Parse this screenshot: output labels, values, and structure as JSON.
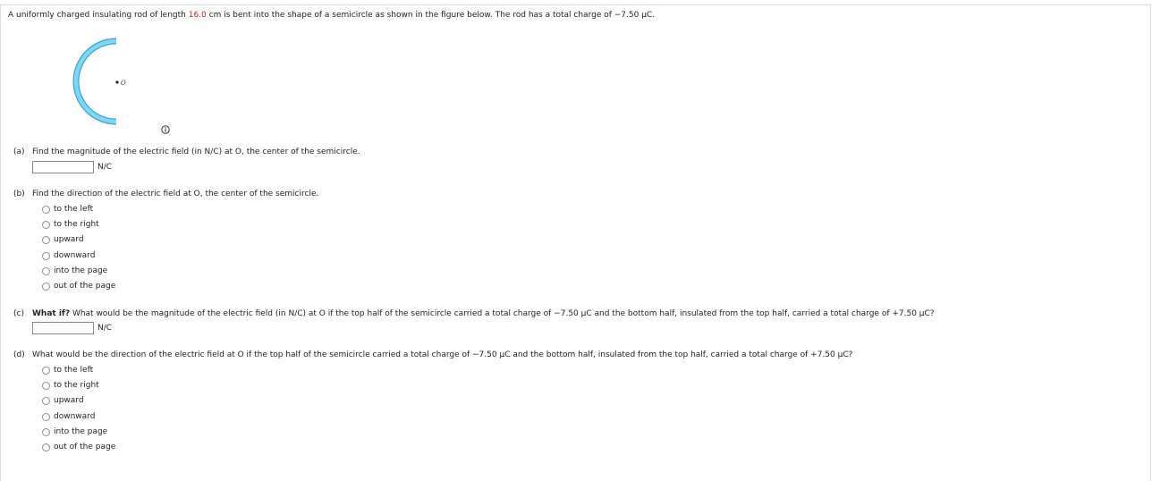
{
  "problem": {
    "intro_before": "A uniformly charged insulating rod of length ",
    "length_value": "16.0",
    "intro_after": " cm is bent into the shape of a semicircle as shown in the figure below. The rod has a total charge of −7.50 µC.",
    "figure_point_label": "O"
  },
  "parts": {
    "a": {
      "label": "(a)",
      "question": "Find the magnitude of the electric field (in N/C) at O, the center of the semicircle.",
      "answer_value": "",
      "unit": "N/C"
    },
    "b": {
      "label": "(b)",
      "question": "Find the direction of the electric field at O, the center of the semicircle.",
      "options": [
        "to the left",
        "to the right",
        "upward",
        "downward",
        "into the page",
        "out of the page"
      ]
    },
    "c": {
      "label": "(c)",
      "bold": "What if?",
      "question": " What would be the magnitude of the electric field (in N/C) at O if the top half of the semicircle carried a total charge of −7.50 µC and the bottom half, insulated from the top half, carried a total charge of +7.50 µC?",
      "answer_value": "",
      "unit": "N/C"
    },
    "d": {
      "label": "(d)",
      "question": "What would be the direction of the electric field at O if the top half of the semicircle carried a total charge of −7.50 µC and the bottom half, insulated from the top half, carried a total charge of +7.50 µC?",
      "options": [
        "to the left",
        "to the right",
        "upward",
        "downward",
        "into the page",
        "out of the page"
      ]
    }
  },
  "colors": {
    "rod": "#5bc8f0",
    "rod_edge": "#3aa6d4",
    "highlight": "#cc2222"
  },
  "icons": {
    "info": "info-icon"
  }
}
